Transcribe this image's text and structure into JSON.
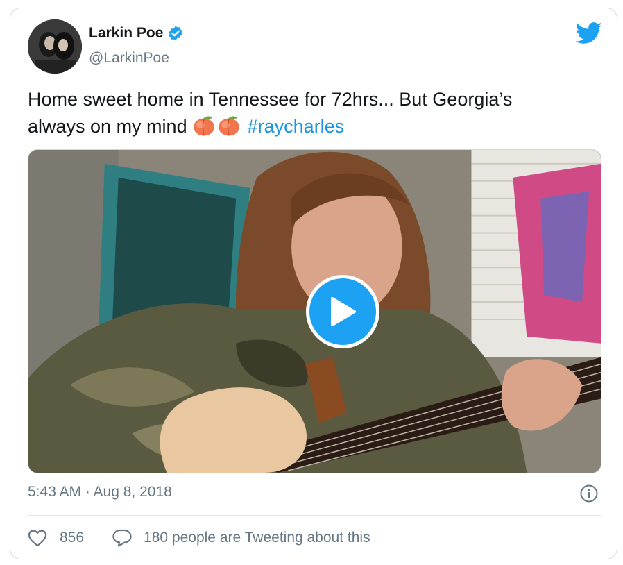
{
  "author": {
    "display_name": "Larkin Poe",
    "handle": "@LarkinPoe",
    "verified": true
  },
  "tweet": {
    "text_line1": "Home sweet home in Tennessee for 72hrs... But Georgia’s",
    "text_line2_prefix": "always on my mind",
    "emojis": [
      "peach",
      "peach"
    ],
    "hashtag": "#raycharles",
    "timestamp": "5:43 AM · Aug 8, 2018"
  },
  "media": {
    "type": "video",
    "play_icon": "play-icon"
  },
  "engagement": {
    "likes": "856",
    "tweeting_text": "180 people are Tweeting about this"
  },
  "colors": {
    "accent": "#1da1f2",
    "hashtag": "#1b95e0",
    "secondary_text": "#657786",
    "border": "#d6dbe0"
  },
  "icons": [
    "verified-badge-icon",
    "twitter-bird-icon",
    "peach-emoji-icon",
    "play-icon",
    "info-icon",
    "heart-icon",
    "speech-bubble-icon"
  ]
}
